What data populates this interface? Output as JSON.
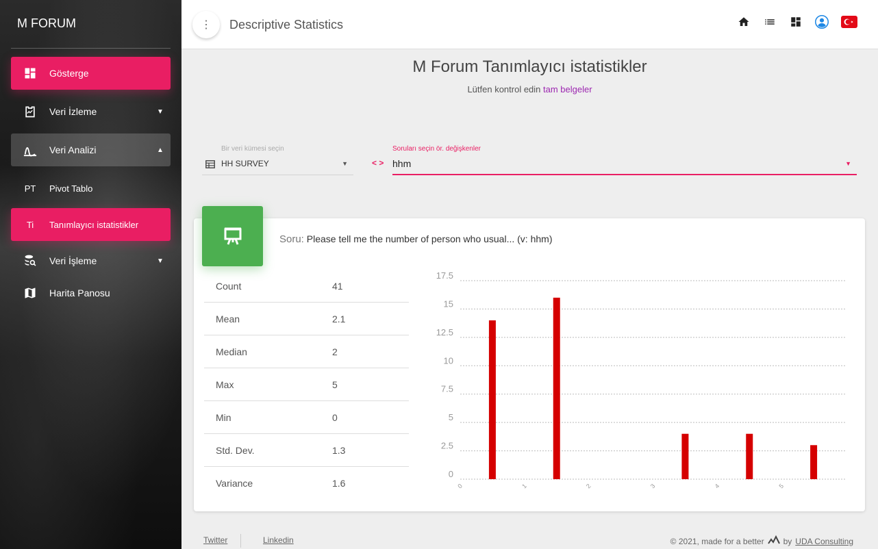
{
  "sidebar": {
    "brand": "M FORUM",
    "items": [
      {
        "label": "Gösterge",
        "icon": "dashboard-icon"
      },
      {
        "label": "Veri İzleme",
        "icon": "monitoring-icon"
      },
      {
        "label": "Veri Analizi",
        "icon": "analysis-icon"
      },
      {
        "label": "Pivot Tablo",
        "abbr": "PT"
      },
      {
        "label": "Tanımlayıcı istatistikler",
        "abbr": "Ti"
      },
      {
        "label": "Veri İşleme",
        "icon": "data-processing-icon"
      },
      {
        "label": "Harita Panosu",
        "icon": "map-icon"
      }
    ]
  },
  "header": {
    "title": "Descriptive Statistics",
    "icons": [
      "home-icon",
      "list-icon",
      "dashboard-icon",
      "account-icon",
      "turkey-flag-icon"
    ]
  },
  "main": {
    "title": "M Forum Tanımlayıcı istatistikler",
    "subtitle_text": "Lütfen kontrol edin ",
    "subtitle_link": "tam belgeler",
    "dataset": {
      "label": "Bir veri kümesi seçin",
      "value": "HH SURVEY"
    },
    "questions": {
      "label": "Soruları seçin ör. değişkenler",
      "value": "hhm"
    }
  },
  "card": {
    "title_prefix": "Soru:",
    "title": " Please tell me the number of person who usual... (v: hhm)",
    "stats": [
      {
        "name": "Count",
        "value": "41"
      },
      {
        "name": "Mean",
        "value": "2.1"
      },
      {
        "name": "Median",
        "value": "2"
      },
      {
        "name": "Max",
        "value": "5"
      },
      {
        "name": "Min",
        "value": "0"
      },
      {
        "name": "Std. Dev.",
        "value": "1.3"
      },
      {
        "name": "Variance",
        "value": "1.6"
      }
    ]
  },
  "chart_data": {
    "type": "bar",
    "categories": [
      "0",
      "1",
      "2",
      "3",
      "4",
      "5"
    ],
    "values": [
      14,
      16,
      0,
      4,
      4,
      3
    ],
    "ylim": [
      0,
      17.5
    ],
    "yticks": [
      "0",
      "2.5",
      "5",
      "7.5",
      "10",
      "12.5",
      "15",
      "17.5"
    ],
    "grid": true,
    "bar_color": "#d50000"
  },
  "footer": {
    "twitter": "Twitter",
    "linkedin": "Linkedin",
    "copyright": "© 2021, made for a better",
    "by": "by",
    "company": "UDA Consulting"
  },
  "colors": {
    "accent": "#e91e63",
    "card_icon": "#4caf50",
    "link": "#9c27b0"
  }
}
